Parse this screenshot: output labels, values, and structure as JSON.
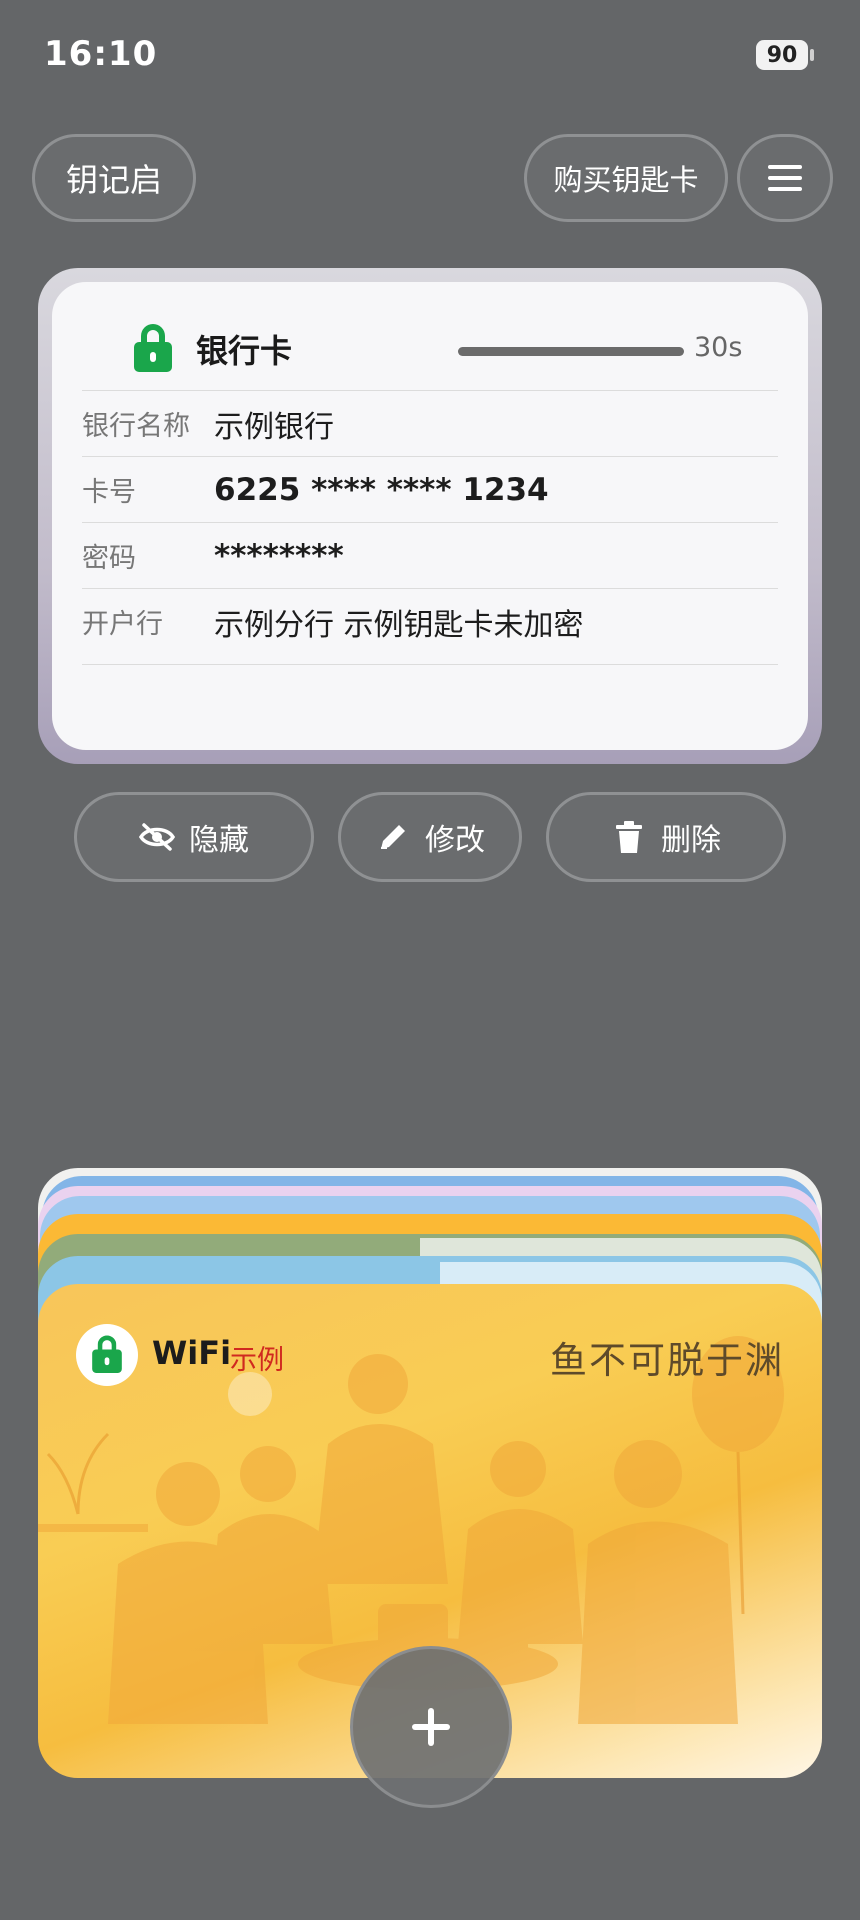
{
  "status_bar": {
    "time": "16:10",
    "battery": "90"
  },
  "top_bar": {
    "app_name": "钥记启",
    "buy_label": "购买钥匙卡",
    "menu_icon": "hamburger-menu-icon"
  },
  "bank_card": {
    "title": "银行卡",
    "lock_icon": "lock-icon",
    "timer_label": "30s",
    "rows": [
      {
        "label": "银行名称",
        "value": "示例银行"
      },
      {
        "label": "卡号",
        "value": "6225 **** **** 1234"
      },
      {
        "label": "密码",
        "value": "********"
      },
      {
        "label": "开户行",
        "value": "示例分行  示例钥匙卡未加密"
      }
    ]
  },
  "actions": {
    "hide": {
      "label": "隐藏",
      "icon": "eye-off-icon"
    },
    "edit": {
      "label": "修改",
      "icon": "pencil-icon"
    },
    "delete": {
      "label": "删除",
      "icon": "trash-icon"
    }
  },
  "wifi_card": {
    "title": "WiFi",
    "tag": "示例",
    "motto": "鱼不可脱于渊",
    "lock_icon": "lock-icon"
  },
  "fab": {
    "icon": "plus-icon"
  },
  "colors": {
    "background": "#646668",
    "lock_green": "#1aa64b",
    "tag_red": "#d0291f",
    "wifi_card_yellow": "#f9cd54"
  }
}
